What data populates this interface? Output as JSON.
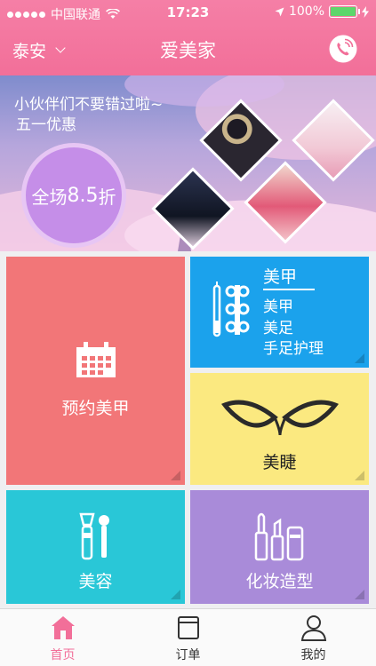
{
  "status": {
    "carrier": "中国联通",
    "time": "17:23",
    "battery": "100%"
  },
  "nav": {
    "city": "泰安",
    "title": "爱美家"
  },
  "banner": {
    "line1": "小伙伴们不要错过啦~",
    "line2": "五一优惠",
    "discount_prefix": "全场",
    "discount_value": "8.5",
    "discount_suffix": "折"
  },
  "tiles": {
    "nail": {
      "label": "预约美甲"
    },
    "manicure": {
      "title": "美甲",
      "items": [
        "美甲",
        "美足",
        "手足护理"
      ]
    },
    "lash": {
      "label": "美睫"
    },
    "beauty": {
      "label": "美容"
    },
    "makeup": {
      "label": "化妆造型"
    }
  },
  "tabs": [
    {
      "label": "首页",
      "icon": "home-icon",
      "active": true
    },
    {
      "label": "订单",
      "icon": "order-icon",
      "active": false
    },
    {
      "label": "我的",
      "icon": "profile-icon",
      "active": false
    }
  ],
  "colors": {
    "brand": "#f26f99",
    "tab_active": "#f26f99"
  }
}
